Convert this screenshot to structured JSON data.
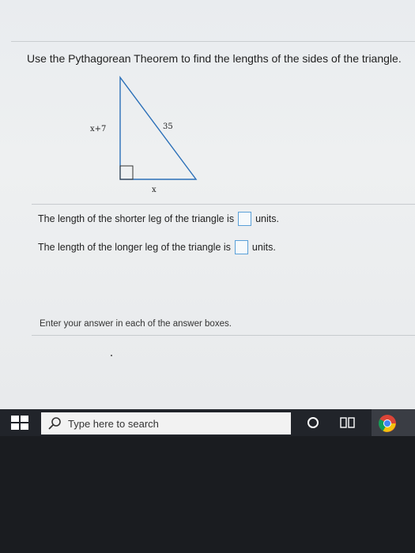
{
  "question": {
    "prompt": "Use the Pythagorean Theorem to find the lengths of the sides of the triangle."
  },
  "figure": {
    "left_leg_label": "x+7",
    "hypotenuse_label": "35",
    "bottom_leg_label": "x"
  },
  "answers": {
    "shorter_prefix": "The length of the shorter leg of the triangle is",
    "shorter_suffix": "units.",
    "longer_prefix": "The length of the longer leg of the triangle is",
    "longer_suffix": "units."
  },
  "instruction": "Enter your answer in each of the answer boxes.",
  "taskbar": {
    "search_placeholder": "Type here to search",
    "icons": [
      "windows-start-icon",
      "search-icon",
      "cortana-icon",
      "task-view-icon",
      "chrome-icon"
    ]
  },
  "colors": {
    "answer_box_border": "#5aa0d8",
    "taskbar": "#21242a"
  }
}
